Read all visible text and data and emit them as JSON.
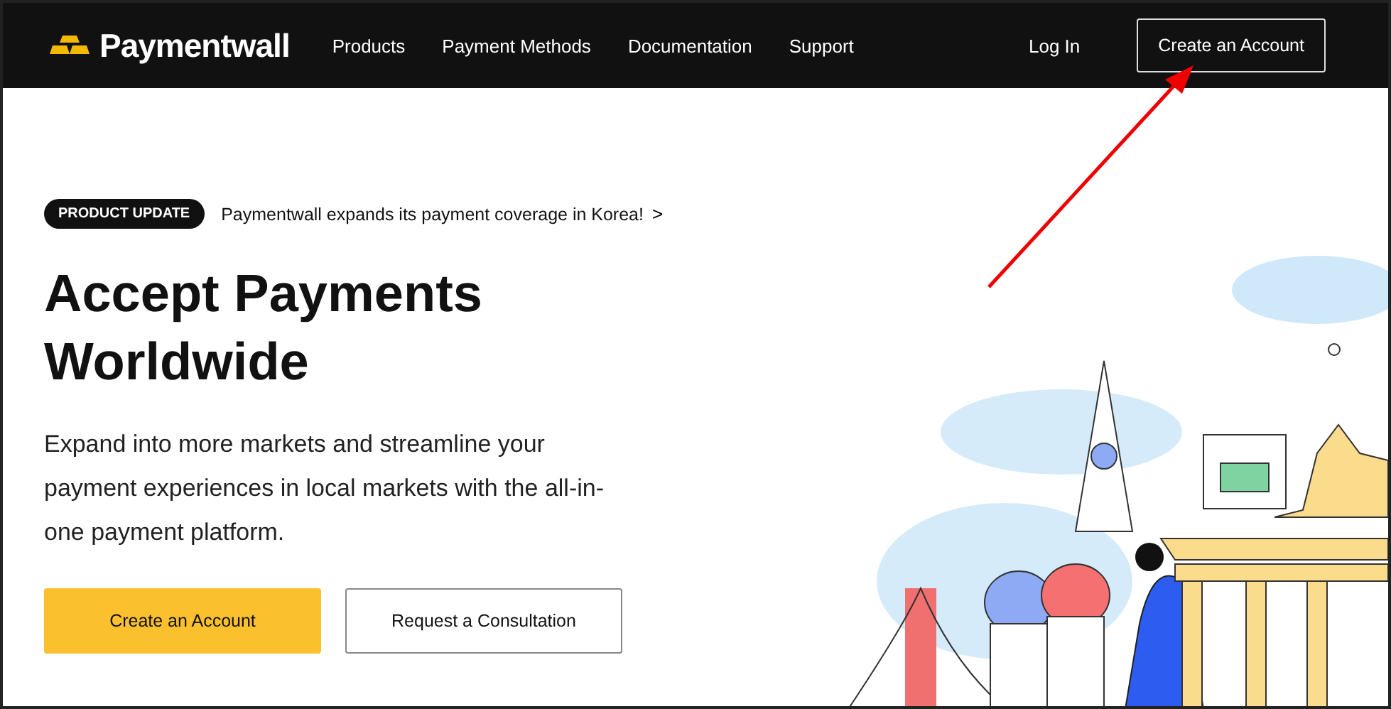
{
  "nav": {
    "brand": "Paymentwall",
    "links": [
      {
        "label": "Products"
      },
      {
        "label": "Payment Methods"
      },
      {
        "label": "Documentation"
      },
      {
        "label": "Support"
      }
    ],
    "login": "Log In",
    "cta": "Create an Account"
  },
  "hero": {
    "badge": "PRODUCT UPDATE",
    "announcement": "Paymentwall expands its payment coverage in Korea!",
    "chevron": ">",
    "title_lines": [
      "Accept Payments",
      "Worldwide"
    ],
    "description": "Expand into more markets and streamline your payment experiences in local markets with the all-in-one payment platform.",
    "buttons": [
      {
        "label": "Create an Account",
        "kind": "primary"
      },
      {
        "label": "Request a Consultation",
        "kind": "secondary"
      }
    ]
  }
}
